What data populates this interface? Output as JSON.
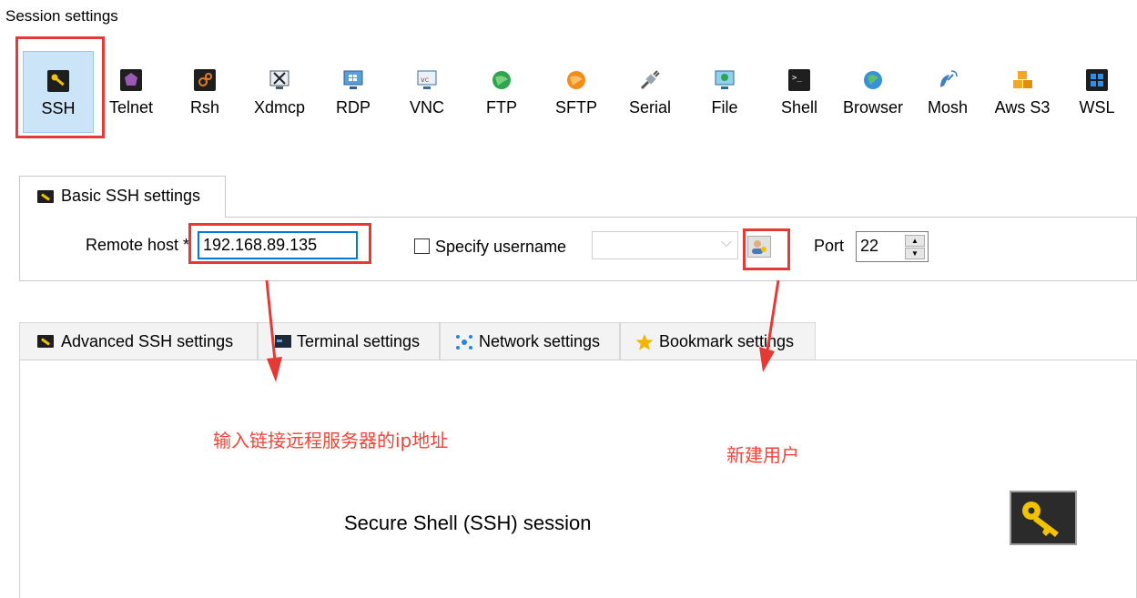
{
  "window": {
    "title": "Session settings"
  },
  "session_types": [
    {
      "label": "SSH",
      "icon": "ssh-key-icon",
      "selected": true
    },
    {
      "label": "Telnet",
      "icon": "telnet-icon"
    },
    {
      "label": "Rsh",
      "icon": "rsh-icon"
    },
    {
      "label": "Xdmcp",
      "icon": "xdmcp-icon"
    },
    {
      "label": "RDP",
      "icon": "rdp-monitor-icon"
    },
    {
      "label": "VNC",
      "icon": "vnc-icon"
    },
    {
      "label": "FTP",
      "icon": "ftp-globe-icon"
    },
    {
      "label": "SFTP",
      "icon": "sftp-globe-icon"
    },
    {
      "label": "Serial",
      "icon": "serial-plug-icon"
    },
    {
      "label": "File",
      "icon": "file-monitor-icon"
    },
    {
      "label": "Shell",
      "icon": "shell-terminal-icon"
    },
    {
      "label": "Browser",
      "icon": "browser-globe-icon"
    },
    {
      "label": "Mosh",
      "icon": "mosh-satellite-icon"
    },
    {
      "label": "Aws S3",
      "icon": "aws-s3-cubes-icon"
    },
    {
      "label": "WSL",
      "icon": "windows-icon"
    }
  ],
  "basic": {
    "tab_label": "Basic SSH settings",
    "remote_host_label": "Remote host *",
    "remote_host_value": "192.168.89.135",
    "specify_username_label": "Specify username",
    "specify_username_checked": false,
    "username_value": "",
    "port_label": "Port",
    "port_value": "22"
  },
  "tabs": [
    {
      "label": "Advanced SSH settings",
      "icon": "ssh-key-icon"
    },
    {
      "label": "Terminal settings",
      "icon": "terminal-icon"
    },
    {
      "label": "Network settings",
      "icon": "network-icon"
    },
    {
      "label": "Bookmark settings",
      "icon": "star-icon"
    }
  ],
  "session_description": "Secure Shell (SSH) session",
  "annotations": {
    "ip_note": "输入链接远程服务器的ip地址",
    "user_note": "新建用户"
  },
  "colors": {
    "annotation_red": "#e53935",
    "selected_bg": "#cce4f7",
    "input_focus_border": "#0078d7",
    "key_gold": "#f2c200"
  }
}
